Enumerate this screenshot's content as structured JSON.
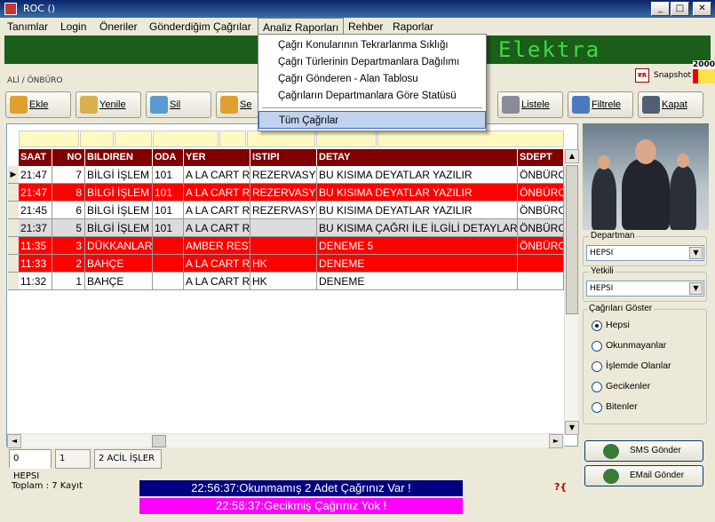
{
  "window": {
    "title": "ROC ()",
    "buttons": [
      "_",
      "□",
      "✕"
    ]
  },
  "menu": [
    "Tanımlar",
    "Login",
    "Öneriler",
    "Gönderdiğim Çağrılar",
    "Analiz Raporları",
    "Rehber",
    "Raporlar"
  ],
  "banner": {
    "text": "Elektra"
  },
  "user_path": "ALİ / ÖNBÜRO",
  "snapshot_label": "Snapshot",
  "year_badge": "2000",
  "toolbar": {
    "ekle": "Ekle",
    "yenile": "Yenile",
    "sil": "Sil",
    "se": "Se",
    "listele": "Listele",
    "filtrele": "Filtrele",
    "kapat": "Kapat"
  },
  "dropdown": {
    "items": [
      "Çağrı Konularının Tekrarlanma Sıklığı",
      "Çağrı Türlerinin Departmanlara Dağılımı",
      "Çağrı Gönderen - Alan Tablosu",
      "Çağrıların Departmanlara Göre Statüsü",
      "Tüm Çağrılar"
    ]
  },
  "grid": {
    "columns": [
      "SAAT",
      "NO",
      "BILDIREN",
      "ODA",
      "YER",
      "ISTIPI",
      "DETAY",
      "SDEPT"
    ],
    "rows": [
      {
        "saat": "21:47",
        "no": "7",
        "bildiren": "BİLGİ İŞLEM",
        "oda": "101",
        "yer": "A LA CART R",
        "istipi": "REZERVASYON",
        "detay": "BU KISIMA DEYATLAR YAZILIR",
        "sdept": "ÖNBÜRO",
        "style": "white",
        "current": "▶"
      },
      {
        "saat": "21:47",
        "no": "8",
        "bildiren": "BİLGİ İŞLEM",
        "oda": "101",
        "yer": "A LA CART R",
        "istipi": "REZERVASYON",
        "detay": "BU KISIMA DEYATLAR YAZILIR",
        "sdept": "ÖNBÜRO",
        "style": "red",
        "current": ""
      },
      {
        "saat": "21:45",
        "no": "6",
        "bildiren": "BİLGİ İŞLEM",
        "oda": "101",
        "yer": "A LA CART R",
        "istipi": "REZERVASYON",
        "detay": "BU KISIMA DEYATLAR YAZILIR",
        "sdept": "ÖNBÜRO",
        "style": "white",
        "current": ""
      },
      {
        "saat": "21:37",
        "no": "5",
        "bildiren": "BİLGİ İŞLEM",
        "oda": "101",
        "yer": "A LA CART R",
        "istipi": "",
        "detay": "BU KISIMA ÇAĞRI İLE İLGİLİ DETAYLAR YAZILIR",
        "sdept": "ÖNBÜRO",
        "style": "grey",
        "current": ""
      },
      {
        "saat": "11:35",
        "no": "3",
        "bildiren": "DÜKKANLAR",
        "oda": "",
        "yer": "AMBER REST",
        "istipi": "",
        "detay": "DENEME 5",
        "sdept": "ÖNBÜRO",
        "style": "red",
        "current": ""
      },
      {
        "saat": "11:33",
        "no": "2",
        "bildiren": "BAHÇE",
        "oda": "",
        "yer": "A LA CART R",
        "istipi": "HK",
        "detay": "DENEME",
        "sdept": "",
        "style": "red",
        "current": ""
      },
      {
        "saat": "11:32",
        "no": "1",
        "bildiren": "BAHÇE",
        "oda": "",
        "yer": "A LA CART R",
        "istipi": "HK",
        "detay": "DENEME",
        "sdept": "",
        "style": "white",
        "current": ""
      }
    ]
  },
  "tabs": [
    "0 HEPSI",
    "1",
    "2 ACİL İŞLER"
  ],
  "status": {
    "toplam": "Toplam : 7 Kayıt",
    "msg1": "22:56:37:Okunmamış 2 Adet Çağrınız Var !",
    "msg2": "22:56:37:Gecikmiş Çağrınız Yok !"
  },
  "right": {
    "departman_label": "Departman",
    "departman_value": "HEPSI",
    "yetkili_label": "Yetkili",
    "yetkili_value": "HEPSI",
    "cagri_label": "Çağrıları Göster",
    "radios": [
      "Hepsi",
      "Okunmayanlar",
      "İşlemde Olanlar",
      "Gecikenler",
      "Bitenler"
    ],
    "radio_selected": 0,
    "sms": "SMS Gönder",
    "email": "EMail Gönder"
  },
  "colors": {
    "row_red": "#ff0000",
    "row_grey": "#dcdcdc",
    "header": "#800000",
    "banner": "#1a5e1a"
  }
}
